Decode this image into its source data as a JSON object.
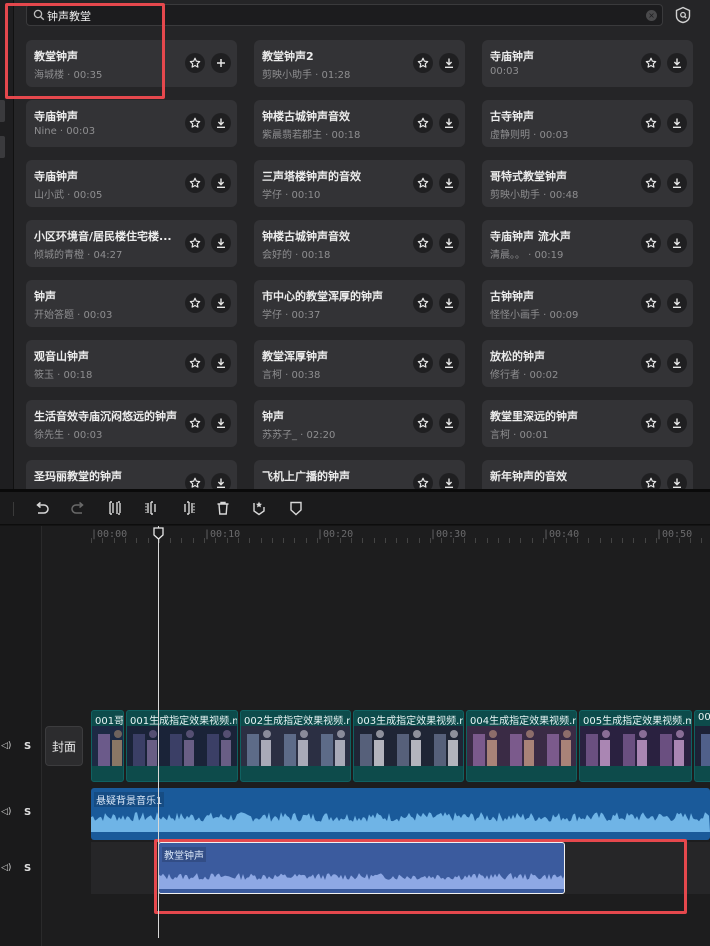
{
  "search": {
    "query": "钟声教堂",
    "clear_icon": "clear-icon"
  },
  "library": {
    "cards": [
      {
        "title": "教堂钟声",
        "meta": "海城楼 · 00:35",
        "action": "add"
      },
      {
        "title": "教堂钟声2",
        "meta": "剪映小助手 · 01:28",
        "action": "download"
      },
      {
        "title": "寺庙钟声",
        "meta": "00:03",
        "action": "download"
      },
      {
        "title": "寺庙钟声",
        "meta": "Nine · 00:03",
        "action": "download"
      },
      {
        "title": "钟楼古城钟声音效",
        "meta": "紫晨翡若郡主 · 00:18",
        "action": "download"
      },
      {
        "title": "古寺钟声",
        "meta": "虚静则明 · 00:03",
        "action": "download"
      },
      {
        "title": "寺庙钟声",
        "meta": "山小武 · 00:05",
        "action": "download"
      },
      {
        "title": "三声塔楼钟声的音效",
        "meta": "学仔 · 00:10",
        "action": "download"
      },
      {
        "title": "哥特式教堂钟声",
        "meta": "剪映小助手 · 00:48",
        "action": "download"
      },
      {
        "title": "小区环境音/居民楼住宅楼...",
        "meta": "倾城的青橙 · 04:27",
        "action": "download"
      },
      {
        "title": "钟楼古城钟声音效",
        "meta": "会好的 · 00:18",
        "action": "download"
      },
      {
        "title": "寺庙钟声 流水声",
        "meta": "清晨。。 · 00:19",
        "action": "download"
      },
      {
        "title": "钟声",
        "meta": "开始答题 · 00:03",
        "action": "download"
      },
      {
        "title": "市中心的教堂浑厚的钟声",
        "meta": "学仔 · 00:37",
        "action": "download"
      },
      {
        "title": "古钟钟声",
        "meta": "怪怪小画手 · 00:09",
        "action": "download"
      },
      {
        "title": "观音山钟声",
        "meta": "筱玉 · 00:18",
        "action": "download"
      },
      {
        "title": "教堂浑厚钟声",
        "meta": "言柯 · 00:38",
        "action": "download"
      },
      {
        "title": "放松的钟声",
        "meta": "修行者 · 00:02",
        "action": "download"
      },
      {
        "title": "生活音效寺庙沉闷悠远的钟声",
        "meta": "徐先生 · 00:03",
        "action": "download"
      },
      {
        "title": "钟声",
        "meta": "苏苏子_ · 02:20",
        "action": "download"
      },
      {
        "title": "教堂里深远的钟声",
        "meta": "言柯 · 00:01",
        "action": "download"
      },
      {
        "title": "圣玛丽教堂的钟声",
        "meta": "",
        "action": "download"
      },
      {
        "title": "飞机上广播的钟声",
        "meta": "",
        "action": "download"
      },
      {
        "title": "新年钟声的音效",
        "meta": "",
        "action": "download"
      }
    ]
  },
  "toolbar": {
    "icons": [
      "undo-icon",
      "redo-icon",
      "split-icon",
      "split-left-icon",
      "split-right-icon",
      "delete-icon",
      "mark-icon",
      "shield-icon"
    ]
  },
  "timeline": {
    "ruler_labels": [
      "|00:00",
      "|00:10",
      "|00:20",
      "|00:30",
      "|00:40",
      "|00:50"
    ],
    "cover_label": "封面",
    "track_toggle": "S",
    "video_clips": [
      "001哥",
      "001生成指定效果视频.m",
      "002生成指定效果视频.m",
      "003生成指定效果视频.m",
      "004生成指定效果视频.m",
      "005生成指定效果视频.m",
      "00"
    ],
    "music_clip": "悬疑背景音乐1",
    "sfx_clip": "教堂钟声"
  },
  "colors": {
    "highlight": "#e5484d",
    "video_clip": "#0d4b4b",
    "music_clip": "#1a5a9a",
    "sfx_clip": "#3b5b9e"
  }
}
